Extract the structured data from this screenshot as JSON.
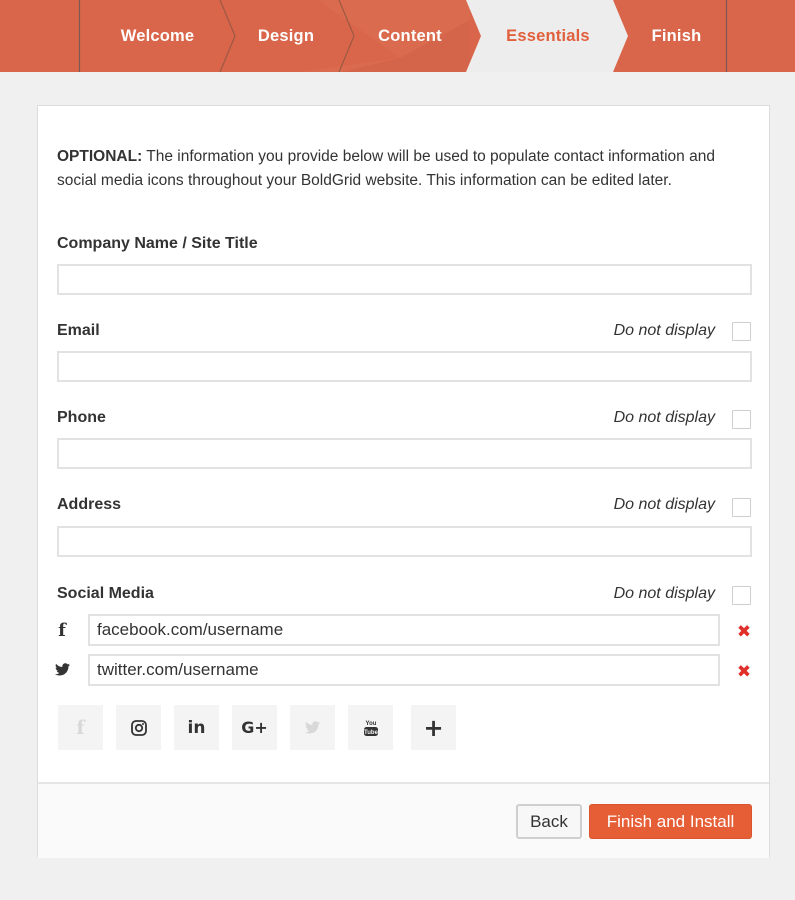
{
  "nav": {
    "steps": [
      {
        "label": "Welcome",
        "state": "done"
      },
      {
        "label": "Design",
        "state": "done"
      },
      {
        "label": "Content",
        "state": "done"
      },
      {
        "label": "Essentials",
        "state": "active"
      },
      {
        "label": "Finish",
        "state": "upcoming"
      }
    ]
  },
  "colors": {
    "nav_bg": "#d9664a",
    "active_step_bg": "#ededed",
    "active_step_text": "#e1603d",
    "primary_button": "#e65e36",
    "remove_icon": "#e0302a"
  },
  "intro": {
    "bold": "OPTIONAL:",
    "text": " The information you provide below will be used to populate contact information and social media icons throughout your BoldGrid website. This information can be edited later."
  },
  "fields": {
    "company": {
      "label": "Company Name / Site Title",
      "value": ""
    },
    "email": {
      "label": "Email",
      "value": "",
      "do_not_display_label": "Do not display",
      "do_not_display_checked": false
    },
    "phone": {
      "label": "Phone",
      "value": "",
      "do_not_display_label": "Do not display",
      "do_not_display_checked": false
    },
    "address": {
      "label": "Address",
      "value": "",
      "do_not_display_label": "Do not display",
      "do_not_display_checked": false
    }
  },
  "social": {
    "label": "Social Media",
    "do_not_display_label": "Do not display",
    "do_not_display_checked": false,
    "entries": [
      {
        "network": "facebook",
        "icon": "facebook-icon",
        "value": "facebook.com/username"
      },
      {
        "network": "twitter",
        "icon": "twitter-icon",
        "value": "twitter.com/username"
      }
    ],
    "add_buttons": [
      {
        "network": "facebook",
        "icon": "facebook-icon",
        "added": true
      },
      {
        "network": "instagram",
        "icon": "instagram-icon",
        "added": false
      },
      {
        "network": "linkedin",
        "icon": "linkedin-icon",
        "added": false
      },
      {
        "network": "google-plus",
        "icon": "google-plus-icon",
        "added": false
      },
      {
        "network": "twitter",
        "icon": "twitter-icon",
        "added": true
      },
      {
        "network": "youtube",
        "icon": "youtube-icon",
        "added": false
      },
      {
        "network": "more",
        "icon": "plus-icon",
        "added": false
      }
    ],
    "linkedin_glyph": "in",
    "gplus_glyph": "G+",
    "facebook_glyph": "f",
    "plus_glyph": "+",
    "remove_glyph": "✖"
  },
  "footer": {
    "back_label": "Back",
    "finish_label": "Finish and Install"
  }
}
